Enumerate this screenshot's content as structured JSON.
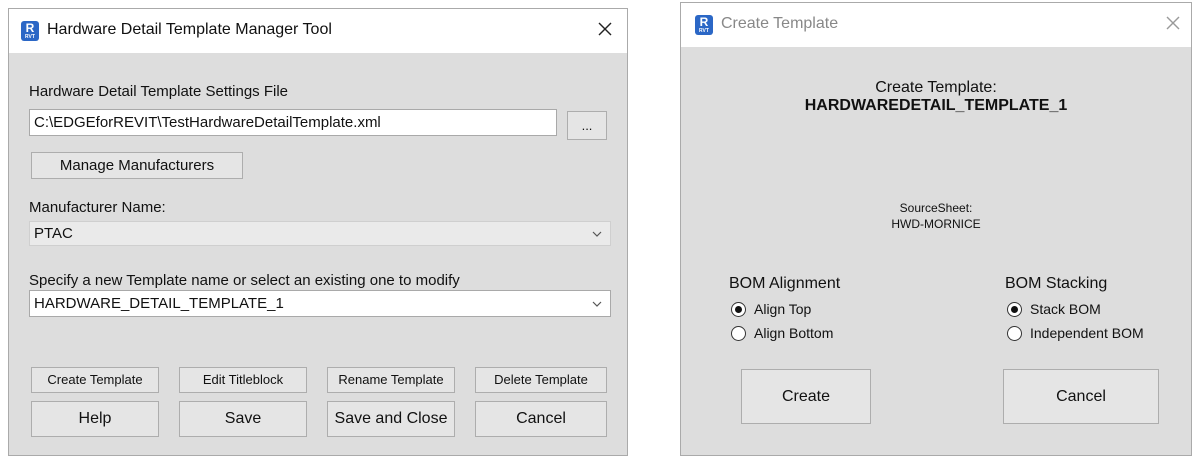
{
  "manager": {
    "title": "Hardware Detail Template Manager Tool",
    "settings_label": "Hardware Detail Template Settings File",
    "settings_path": "C:\\EDGEforREVIT\\TestHardwareDetailTemplate.xml",
    "browse_label": "...",
    "manage_manufacturers_label": "Manage Manufacturers",
    "manufacturer_label": "Manufacturer Name:",
    "manufacturer_value": "PTAC",
    "template_label": "Specify a new Template name or select an existing one to modify",
    "template_value": "HARDWARE_DETAIL_TEMPLATE_1",
    "buttons": {
      "create_template": "Create Template",
      "edit_titleblock": "Edit Titleblock",
      "rename_template": "Rename Template",
      "delete_template": "Delete Template",
      "help": "Help",
      "save": "Save",
      "save_and_close": "Save and Close",
      "cancel": "Cancel"
    }
  },
  "create_dialog": {
    "title": "Create Template",
    "heading_line1": "Create Template:",
    "heading_line2": "HARDWAREDETAIL_TEMPLATE_1",
    "sourcesheet_label": "SourceSheet:",
    "sourcesheet_value": "HWD-MORNICE",
    "bom_alignment": {
      "label": "BOM Alignment",
      "options": [
        {
          "label": "Align Top",
          "selected": true
        },
        {
          "label": "Align Bottom",
          "selected": false
        }
      ]
    },
    "bom_stacking": {
      "label": "BOM Stacking",
      "options": [
        {
          "label": "Stack BOM",
          "selected": true
        },
        {
          "label": "Independent BOM",
          "selected": false
        }
      ]
    },
    "create_label": "Create",
    "cancel_label": "Cancel"
  },
  "icons": {
    "app_icon_letter": "R",
    "app_icon_caption": "RVT",
    "app_icon_color": "#2b67c6"
  }
}
